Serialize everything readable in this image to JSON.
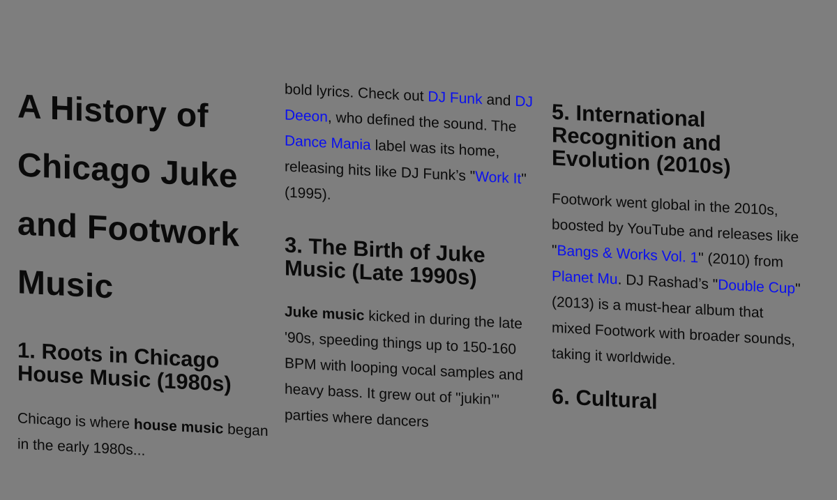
{
  "col1": {
    "title": "A History of Chicago Juke and Footwork Music",
    "section1_heading": "1. Roots in Chicago House Music (1980s)",
    "section1_text_a": "Chicago is where ",
    "section1_bold": "house music",
    "section1_text_b": " began in the early 1980s..."
  },
  "col2": {
    "p1_a": "bold lyrics. Check out ",
    "link_dj_funk": "DJ Funk",
    "p1_b": " and ",
    "link_dj_deeon": "DJ Deeon",
    "p1_c": ", who defined the sound. The ",
    "link_dance_mania": "Dance Mania",
    "p1_d": " label was its home, releasing hits like DJ Funk’s \"",
    "link_work_it": "Work It",
    "p1_e": "\" (1995).",
    "section3_heading": "3. The Birth of Juke Music (Late 1990s)",
    "p2_bold": "Juke music",
    "p2_a": " kicked in during the late '90s, speeding things up to 150-160 BPM with looping vocal samples and heavy bass. It grew out of \"jukin’\" parties where dancers"
  },
  "col3": {
    "section5_heading": "5. International Recognition and Evolution (2010s)",
    "p_a": "Footwork went global in the 2010s, boosted by YouTube and releases like \"",
    "link_bangs": "Bangs & Works Vol. 1",
    "p_b": "\" (2010) from ",
    "link_planet_mu": "Planet Mu",
    "p_c": ". DJ Rashad’s \"",
    "link_double_cup": "Double Cup",
    "p_d": "\" (2013) is a must-hear album that mixed Footwork with broader sounds, taking it worldwide.",
    "section6_heading": "6. Cultural"
  }
}
